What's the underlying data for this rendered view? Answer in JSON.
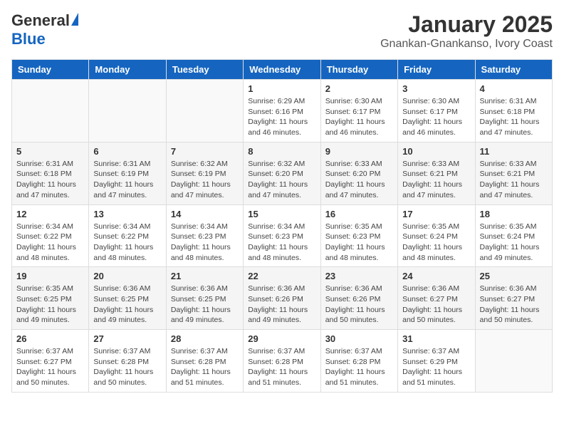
{
  "header": {
    "logo_general": "General",
    "logo_blue": "Blue",
    "month_title": "January 2025",
    "location": "Gnankan-Gnankanso, Ivory Coast"
  },
  "days_of_week": [
    "Sunday",
    "Monday",
    "Tuesday",
    "Wednesday",
    "Thursday",
    "Friday",
    "Saturday"
  ],
  "weeks": [
    [
      {
        "day": "",
        "info": ""
      },
      {
        "day": "",
        "info": ""
      },
      {
        "day": "",
        "info": ""
      },
      {
        "day": "1",
        "info": "Sunrise: 6:29 AM\nSunset: 6:16 PM\nDaylight: 11 hours and 46 minutes."
      },
      {
        "day": "2",
        "info": "Sunrise: 6:30 AM\nSunset: 6:17 PM\nDaylight: 11 hours and 46 minutes."
      },
      {
        "day": "3",
        "info": "Sunrise: 6:30 AM\nSunset: 6:17 PM\nDaylight: 11 hours and 46 minutes."
      },
      {
        "day": "4",
        "info": "Sunrise: 6:31 AM\nSunset: 6:18 PM\nDaylight: 11 hours and 47 minutes."
      }
    ],
    [
      {
        "day": "5",
        "info": "Sunrise: 6:31 AM\nSunset: 6:18 PM\nDaylight: 11 hours and 47 minutes."
      },
      {
        "day": "6",
        "info": "Sunrise: 6:31 AM\nSunset: 6:19 PM\nDaylight: 11 hours and 47 minutes."
      },
      {
        "day": "7",
        "info": "Sunrise: 6:32 AM\nSunset: 6:19 PM\nDaylight: 11 hours and 47 minutes."
      },
      {
        "day": "8",
        "info": "Sunrise: 6:32 AM\nSunset: 6:20 PM\nDaylight: 11 hours and 47 minutes."
      },
      {
        "day": "9",
        "info": "Sunrise: 6:33 AM\nSunset: 6:20 PM\nDaylight: 11 hours and 47 minutes."
      },
      {
        "day": "10",
        "info": "Sunrise: 6:33 AM\nSunset: 6:21 PM\nDaylight: 11 hours and 47 minutes."
      },
      {
        "day": "11",
        "info": "Sunrise: 6:33 AM\nSunset: 6:21 PM\nDaylight: 11 hours and 47 minutes."
      }
    ],
    [
      {
        "day": "12",
        "info": "Sunrise: 6:34 AM\nSunset: 6:22 PM\nDaylight: 11 hours and 48 minutes."
      },
      {
        "day": "13",
        "info": "Sunrise: 6:34 AM\nSunset: 6:22 PM\nDaylight: 11 hours and 48 minutes."
      },
      {
        "day": "14",
        "info": "Sunrise: 6:34 AM\nSunset: 6:23 PM\nDaylight: 11 hours and 48 minutes."
      },
      {
        "day": "15",
        "info": "Sunrise: 6:34 AM\nSunset: 6:23 PM\nDaylight: 11 hours and 48 minutes."
      },
      {
        "day": "16",
        "info": "Sunrise: 6:35 AM\nSunset: 6:23 PM\nDaylight: 11 hours and 48 minutes."
      },
      {
        "day": "17",
        "info": "Sunrise: 6:35 AM\nSunset: 6:24 PM\nDaylight: 11 hours and 48 minutes."
      },
      {
        "day": "18",
        "info": "Sunrise: 6:35 AM\nSunset: 6:24 PM\nDaylight: 11 hours and 49 minutes."
      }
    ],
    [
      {
        "day": "19",
        "info": "Sunrise: 6:35 AM\nSunset: 6:25 PM\nDaylight: 11 hours and 49 minutes."
      },
      {
        "day": "20",
        "info": "Sunrise: 6:36 AM\nSunset: 6:25 PM\nDaylight: 11 hours and 49 minutes."
      },
      {
        "day": "21",
        "info": "Sunrise: 6:36 AM\nSunset: 6:25 PM\nDaylight: 11 hours and 49 minutes."
      },
      {
        "day": "22",
        "info": "Sunrise: 6:36 AM\nSunset: 6:26 PM\nDaylight: 11 hours and 49 minutes."
      },
      {
        "day": "23",
        "info": "Sunrise: 6:36 AM\nSunset: 6:26 PM\nDaylight: 11 hours and 50 minutes."
      },
      {
        "day": "24",
        "info": "Sunrise: 6:36 AM\nSunset: 6:27 PM\nDaylight: 11 hours and 50 minutes."
      },
      {
        "day": "25",
        "info": "Sunrise: 6:36 AM\nSunset: 6:27 PM\nDaylight: 11 hours and 50 minutes."
      }
    ],
    [
      {
        "day": "26",
        "info": "Sunrise: 6:37 AM\nSunset: 6:27 PM\nDaylight: 11 hours and 50 minutes."
      },
      {
        "day": "27",
        "info": "Sunrise: 6:37 AM\nSunset: 6:28 PM\nDaylight: 11 hours and 50 minutes."
      },
      {
        "day": "28",
        "info": "Sunrise: 6:37 AM\nSunset: 6:28 PM\nDaylight: 11 hours and 51 minutes."
      },
      {
        "day": "29",
        "info": "Sunrise: 6:37 AM\nSunset: 6:28 PM\nDaylight: 11 hours and 51 minutes."
      },
      {
        "day": "30",
        "info": "Sunrise: 6:37 AM\nSunset: 6:28 PM\nDaylight: 11 hours and 51 minutes."
      },
      {
        "day": "31",
        "info": "Sunrise: 6:37 AM\nSunset: 6:29 PM\nDaylight: 11 hours and 51 minutes."
      },
      {
        "day": "",
        "info": ""
      }
    ]
  ]
}
